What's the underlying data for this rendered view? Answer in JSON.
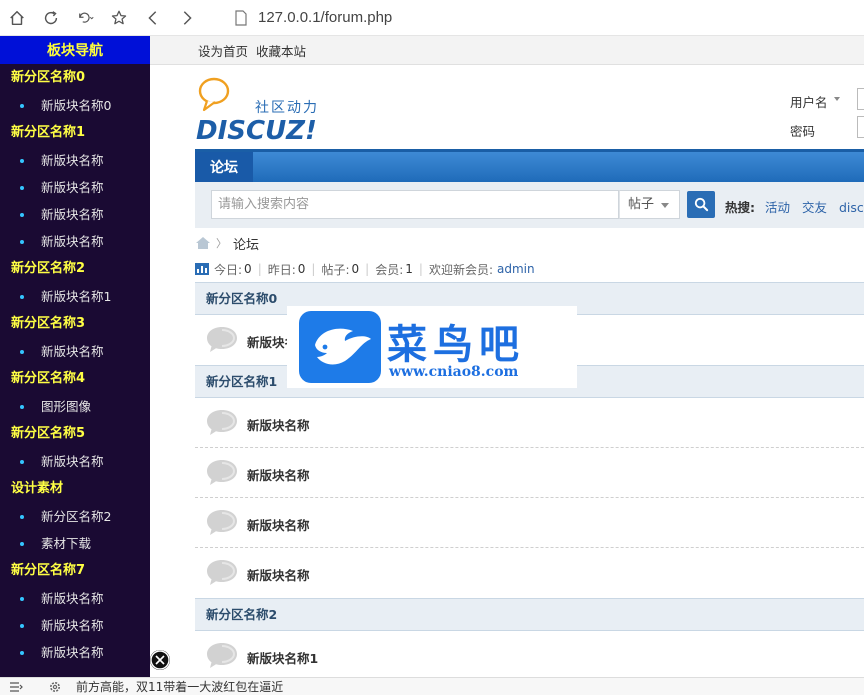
{
  "browser": {
    "url": "127.0.0.1/forum.php"
  },
  "sidebar": {
    "title": "板块导航",
    "entries": [
      {
        "type": "group",
        "label": "新分区名称0"
      },
      {
        "type": "item",
        "label": "新版块名称0"
      },
      {
        "type": "group",
        "label": "新分区名称1"
      },
      {
        "type": "item",
        "label": "新版块名称"
      },
      {
        "type": "item",
        "label": "新版块名称"
      },
      {
        "type": "item",
        "label": "新版块名称"
      },
      {
        "type": "item",
        "label": "新版块名称"
      },
      {
        "type": "group",
        "label": "新分区名称2"
      },
      {
        "type": "item",
        "label": "新版块名称1"
      },
      {
        "type": "group",
        "label": "新分区名称3"
      },
      {
        "type": "item",
        "label": "新版块名称"
      },
      {
        "type": "group",
        "label": "新分区名称4"
      },
      {
        "type": "item",
        "label": "图形图像"
      },
      {
        "type": "group",
        "label": "新分区名称5"
      },
      {
        "type": "item",
        "label": "新版块名称"
      },
      {
        "type": "group",
        "label": "设计素材"
      },
      {
        "type": "item",
        "label": "新分区名称2"
      },
      {
        "type": "item",
        "label": "素材下载"
      },
      {
        "type": "group",
        "label": "新分区名称7"
      },
      {
        "type": "item",
        "label": "新版块名称"
      },
      {
        "type": "item",
        "label": "新版块名称"
      },
      {
        "type": "item",
        "label": "新版块名称"
      }
    ]
  },
  "toplinks": {
    "set_home": "设为首页",
    "bookmark": "收藏本站"
  },
  "logo": {
    "slogan": "社区动力",
    "brand": "DISCUZ!"
  },
  "login": {
    "username_label": "用户名",
    "password_label": "密码"
  },
  "nav": {
    "active_tab": "论坛"
  },
  "search": {
    "placeholder": "请输入搜索内容",
    "type": "帖子",
    "hot_label": "热搜:",
    "hot_links": [
      "活动",
      "交友",
      "discuz"
    ]
  },
  "breadcrumb": {
    "current": "论坛"
  },
  "stats": {
    "today_label": "今日:",
    "today": "0",
    "yesterday_label": "昨日:",
    "yesterday": "0",
    "posts_label": "帖子:",
    "posts": "0",
    "members_label": "会员:",
    "members": "1",
    "newest_label": "欢迎新会员:",
    "newest": "admin"
  },
  "categories": [
    {
      "title": "新分区名称0",
      "forums": [
        "新版块名称0"
      ]
    },
    {
      "title": "新分区名称1",
      "forums": [
        "新版块名称",
        "新版块名称",
        "新版块名称",
        "新版块名称"
      ]
    },
    {
      "title": "新分区名称2",
      "forums": [
        "新版块名称1"
      ]
    }
  ],
  "watermark": {
    "title": "菜鸟吧",
    "url": "www.cniao8.com"
  },
  "statusbar": {
    "text": "前方高能，双11带着一大波红包在逼近"
  },
  "colors": {
    "sidebar_bg": "#1a0a33",
    "sidebar_head_bg": "#0010d8",
    "sidebar_group": "#ffff44",
    "nav_blue": "#2a6db5"
  }
}
